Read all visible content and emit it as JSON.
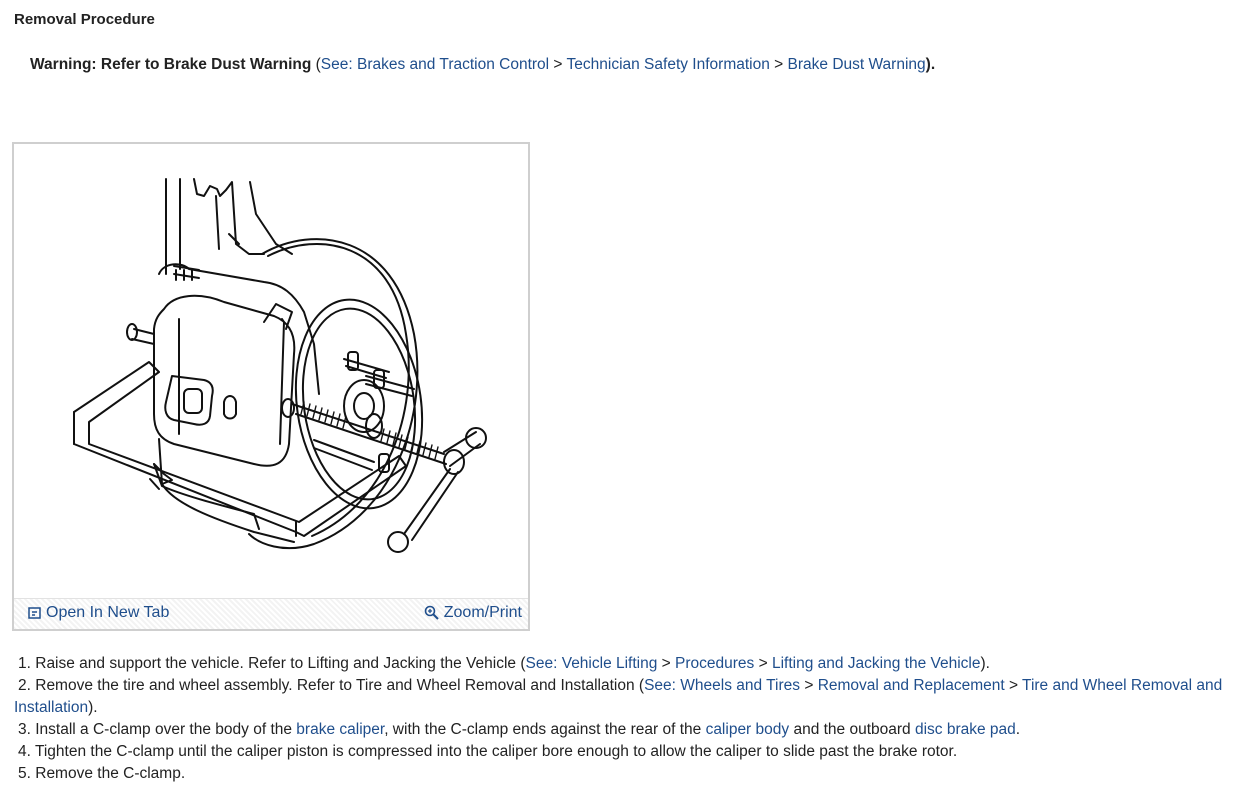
{
  "title": "Removal Procedure",
  "warning": {
    "label": "Warning: Refer to Brake Dust Warning",
    "open_paren": " (",
    "see": "See: Brakes and Traction Control",
    "sep1": " > ",
    "crumb2": "Technician Safety Information",
    "sep2": " > ",
    "crumb3": "Brake Dust Warning",
    "close": ")."
  },
  "figure": {
    "open_tab_label": "Open In New Tab",
    "zoom_label": "Zoom/Print"
  },
  "steps": [
    {
      "num": "1.",
      "text": " Raise and support the vehicle. Refer to Lifting and Jacking the Vehicle (",
      "link1": "See: Vehicle Lifting",
      "sep1": " > ",
      "link2": "Procedures",
      "sep2": " > ",
      "link3": "Lifting and Jacking the Vehicle",
      "close": ")."
    },
    {
      "num": "2.",
      "text": " Remove the tire and wheel assembly. Refer to Tire and Wheel Removal and Installation (",
      "link1": "See: Wheels and Tires",
      "sep1": " > ",
      "link2": "Removal and Replacement",
      "sep2": " > ",
      "link3": "Tire and Wheel Removal and Installation",
      "close": ")."
    },
    {
      "num": "3.",
      "text_a": " Install a C-clamp over the body of the ",
      "link1": "brake caliper",
      "text_b": ", with the C-clamp ends against the rear of the ",
      "link2": "caliper body",
      "text_c": " and the outboard ",
      "link3": "disc brake pad",
      "text_d": "."
    },
    {
      "num": "4.",
      "text": " Tighten the C-clamp until the caliper piston is compressed into the caliper bore enough to allow the caliper to slide past the brake rotor."
    },
    {
      "num": "5.",
      "text": " Remove the C-clamp."
    }
  ]
}
